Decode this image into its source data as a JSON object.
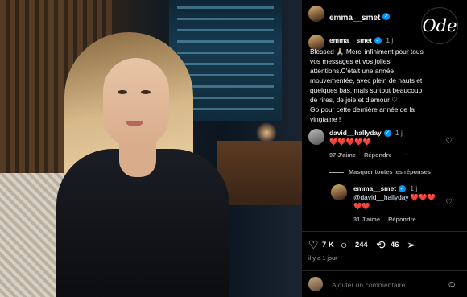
{
  "post": {
    "author": "emma__smet",
    "caption_author": "emma__smet",
    "caption_time": "1 j",
    "caption_lines": [
      "Blessed 🙏🏼 Merci infiniment pour tous",
      "vos messages et vos jolies",
      "attentions.C'était une année",
      "mouvementée, avec plein de hauts et",
      "quelques bas, mais surtout beaucoup",
      "de rires, de joie et d'amour ♡",
      "Go pour cette dernière année de la",
      "vingtaine !"
    ]
  },
  "logo_text": "Ode",
  "comments": [
    {
      "author": "david__hallyday",
      "time": "1 j",
      "text": "❤️❤️❤️❤️❤️",
      "likes": "97 J'aime",
      "reply_label": "Répondre",
      "more": "···"
    }
  ],
  "hide_replies": "Masquer toutes les réponses",
  "reply": {
    "author": "emma__smet",
    "time": "1 j",
    "mention": "@david__hallyday",
    "hearts_line1": "❤️❤️❤️",
    "hearts_line2": "❤️❤️",
    "likes": "31 J'aime",
    "reply_label": "Répondre"
  },
  "actions": {
    "likes": "7 K",
    "comments": "244",
    "reposts": "46"
  },
  "time_ago": "il y a 1 jour",
  "add_comment_placeholder": "Ajouter un commentaire…",
  "colors": {
    "verified": "#0095f6",
    "muted": "#a8a8a8",
    "background": "#000000"
  },
  "icons": [
    "heart-icon",
    "comment-icon",
    "repost-icon",
    "share-icon",
    "emoji-icon",
    "verified-badge-icon"
  ]
}
